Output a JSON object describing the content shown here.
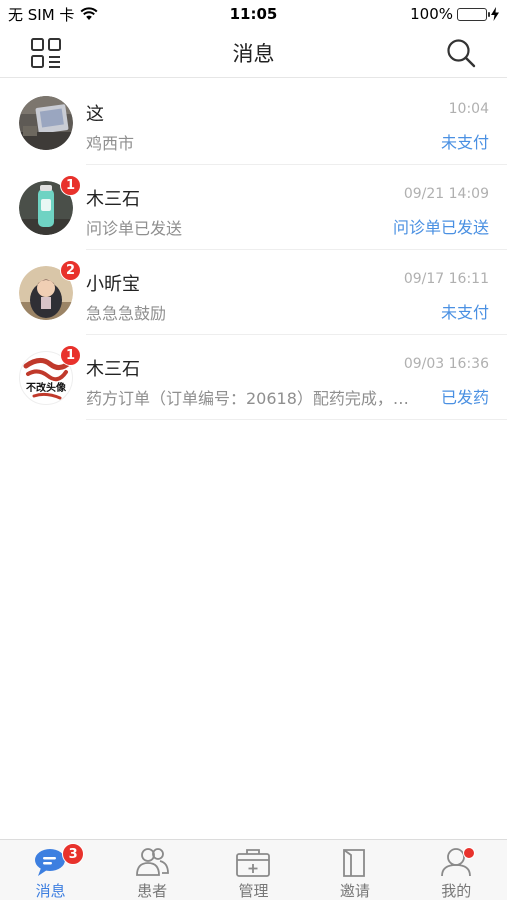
{
  "status_bar": {
    "carrier": "无 SIM 卡",
    "time": "11:05",
    "battery": "100%",
    "battery_level": 1.0
  },
  "nav": {
    "title": "消息",
    "left_icon": "qr-scan-icon",
    "right_icon": "search-icon"
  },
  "conversations": [
    {
      "name": "这",
      "time": "10:04",
      "preview": "鸡西市",
      "status": "未支付",
      "badge": ""
    },
    {
      "name": "木三石",
      "time": "09/21 14:09",
      "preview": "问诊单已发送",
      "status": "问诊单已发送",
      "badge": "1"
    },
    {
      "name": "小昕宝",
      "time": "09/17 16:11",
      "preview": "急急急鼓励",
      "status": "未支付",
      "badge": "2"
    },
    {
      "name": "木三石",
      "time": "09/03 16:36",
      "preview": "药方订单（订单编号：20618）配药完成，…",
      "status": "已发药",
      "badge": "1",
      "avatar_text": "不改头像"
    }
  ],
  "tabbar": {
    "items": [
      {
        "label": "消息",
        "icon": "chat-bubble-icon",
        "badge": "3",
        "active": true
      },
      {
        "label": "患者",
        "icon": "patients-icon",
        "badge": "",
        "active": false
      },
      {
        "label": "管理",
        "icon": "medical-kit-icon",
        "badge": "",
        "active": false
      },
      {
        "label": "邀请",
        "icon": "book-icon",
        "badge": "",
        "active": false
      },
      {
        "label": "我的",
        "icon": "profile-icon",
        "badge": "",
        "dot": true,
        "active": false
      }
    ]
  },
  "colors": {
    "accent": "#3d7fe0",
    "status_blue": "#4a90e2",
    "badge_red": "#e8322c",
    "battery_green": "#4cd964"
  }
}
